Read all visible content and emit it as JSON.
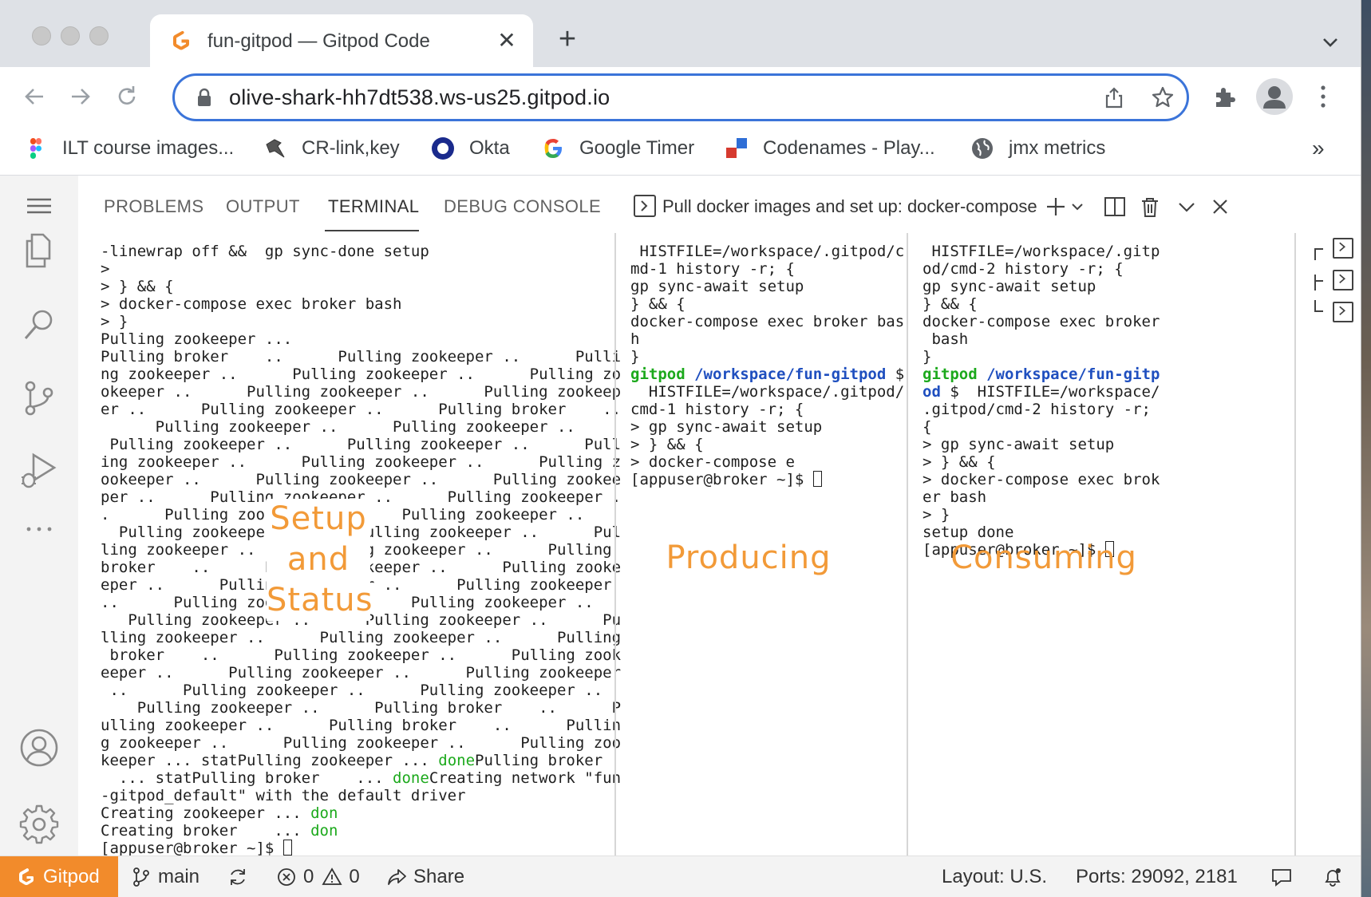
{
  "browser": {
    "tab": {
      "title": "fun-gitpod — Gitpod Code",
      "favicon": "gitpod-logo-icon"
    },
    "url": "olive-shark-hh7dt538.ws-us25.gitpod.io",
    "bookmarks": [
      {
        "label": "ILT course images...",
        "icon": "figma-icon"
      },
      {
        "label": "CR-link,key",
        "icon": "bird-icon"
      },
      {
        "label": "Okta",
        "icon": "okta-icon"
      },
      {
        "label": "Google Timer",
        "icon": "google-icon"
      },
      {
        "label": "Codenames - Play...",
        "icon": "codenames-icon"
      },
      {
        "label": "jmx metrics",
        "icon": "globe-icon"
      }
    ],
    "bookmarks_more": "»"
  },
  "panel": {
    "tabs": [
      "PROBLEMS",
      "OUTPUT",
      "TERMINAL",
      "DEBUG CONSOLE"
    ],
    "active_tab": "TERMINAL",
    "terminal_title": "Pull docker images and set up: docker-compose"
  },
  "terminals": {
    "left": [
      "-linewrap off &&  gp sync-done setup",
      ">",
      "> } && {",
      "> docker-compose exec broker bash",
      "> }",
      "Pulling zookeeper ...",
      "Pulling broker    ..      Pulling zookeeper ..      Pulli",
      "ng zookeeper ..      Pulling zookeeper ..      Pulling zo",
      "okeeper ..      Pulling zookeeper ..      Pulling zookeep",
      "er ..      Pulling zookeeper ..      Pulling broker    ..",
      "      Pulling zookeeper ..      Pulling zookeeper ..",
      " Pulling zookeeper ..      Pulling zookeeper ..      Pull",
      "ing zookeeper ..      Pulling zookeeper ..      Pulling z",
      "ookeeper ..      Pulling zookeeper ..      Pulling zookee",
      "per ..      Pulling zookeeper ..      Pulling zookeeper .",
      ".      Pulling zookeeper ..      Pulling zookeeper ..",
      "  Pulling zookeeper ..      Pulling zookeeper ..      Pul",
      "ling zookeeper ..      Pulling zookeeper ..      Pulling",
      "broker    ..      Pulling zookeeper ..      Pulling zooke",
      "eper ..      Pulling zookeeper ..      Pulling zookeeper",
      "..      Pulling zookeeper ..      Pulling zookeeper ..",
      "   Pulling zookeeper ..      Pulling zookeeper ..      Pu",
      "lling zookeeper ..      Pulling zookeeper ..      Pulling",
      " broker    ..      Pulling zookeeper ..      Pulling zook",
      "eeper ..      Pulling zookeeper ..      Pulling zookeeper",
      " ..      Pulling zookeeper ..      Pulling zookeeper ..",
      "    Pulling zookeeper ..      Pulling broker    ..      P",
      "ulling zookeeper ..      Pulling broker    ..      Pullin",
      "g zookeeper ..      Pulling zookeeper ..      Pulling zoo",
      "keeper ... statPulling zookeeper ... donePulling broker",
      "  ... statPulling broker    ... doneCreating network \"fun",
      "-gitpod_default\" with the default driver",
      "Creating zookeeper ... don",
      "Creating broker    ... don",
      "[appuser@broker ~]$ "
    ],
    "middle": [
      " HISTFILE=/workspace/.gitpod/c",
      "md-1 history -r; {",
      "gp sync-await setup",
      "} && {",
      "docker-compose exec broker bas",
      "h",
      "}",
      "gitpod /workspace/fun-gitpod $",
      "  HISTFILE=/workspace/.gitpod/",
      "cmd-1 history -r; {",
      "> gp sync-await setup",
      "> } && {",
      "> docker-compose e",
      "[appuser@broker ~]$ "
    ],
    "right": [
      " HISTFILE=/workspace/.gitp",
      "od/cmd-2 history -r; {",
      "gp sync-await setup",
      "} && {",
      "docker-compose exec broker",
      " bash",
      "}",
      "gitpod /workspace/fun-gitp",
      "od $  HISTFILE=/workspace/",
      ".gitpod/cmd-2 history -r;",
      "{",
      "> gp sync-await setup",
      "> } && {",
      "> docker-compose exec brok",
      "er bash",
      "> }",
      "setup done",
      "[appuser@broker ~]$ "
    ]
  },
  "prompt_parts": {
    "user": "gitpod",
    "path_mid": "/workspace/fun-gitpod",
    "path_right_a": "/workspace/fun-gitp",
    "path_right_b": "od",
    "dollar": " $",
    "done": "done",
    "don": "don"
  },
  "overlays": {
    "setup": [
      "Setup",
      "and",
      "Status"
    ],
    "producing": "Producing",
    "consuming": "Consuming"
  },
  "statusbar": {
    "remote": "Gitpod",
    "branch": "main",
    "errors": "0",
    "warnings": "0",
    "share": "Share",
    "layout": "Layout: U.S.",
    "ports": "Ports: 29092, 2181"
  },
  "colors": {
    "accent": "#3b74d9",
    "gitpod_orange": "#f28b2b",
    "overlay_orange": "#f29a38",
    "prompt_green": "#1ca91c",
    "prompt_blue": "#1f4fbf"
  }
}
